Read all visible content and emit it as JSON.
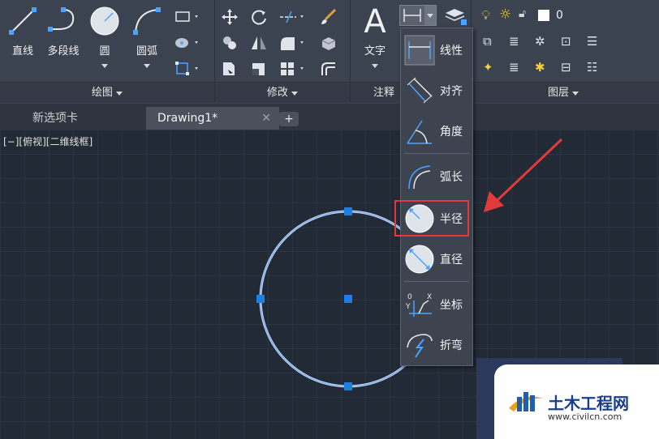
{
  "ribbon": {
    "draw_panel": {
      "title": "绘图",
      "tools": {
        "line": "直线",
        "polyline": "多段线",
        "circle": "圆",
        "arc": "圆弧"
      }
    },
    "modify_panel": {
      "title": "修改"
    },
    "annotate_panel": {
      "title": "注释",
      "text_tool": "文字"
    },
    "layers_panel": {
      "title": "图层",
      "current_layer": "0"
    }
  },
  "tabs": [
    {
      "label": "新选项卡"
    },
    {
      "label": "Drawing1*"
    }
  ],
  "viewport": {
    "label": "[−][俯视][二维线框]"
  },
  "dimension_menu": {
    "items": [
      {
        "label": "线性"
      },
      {
        "label": "对齐"
      },
      {
        "label": "角度"
      },
      {
        "label": "弧长"
      },
      {
        "label": "半径"
      },
      {
        "label": "直径"
      },
      {
        "label": "坐标"
      },
      {
        "label": "折弯"
      }
    ],
    "highlighted_item": "半径"
  },
  "colors": {
    "accent_red": "#e23a3a",
    "grip_blue": "#1e7fe0",
    "ribbon_bg": "#3b4250",
    "canvas_bg": "#222a35"
  },
  "watermark": {
    "brand": "土木工程网",
    "url": "www.civilcn.com"
  }
}
